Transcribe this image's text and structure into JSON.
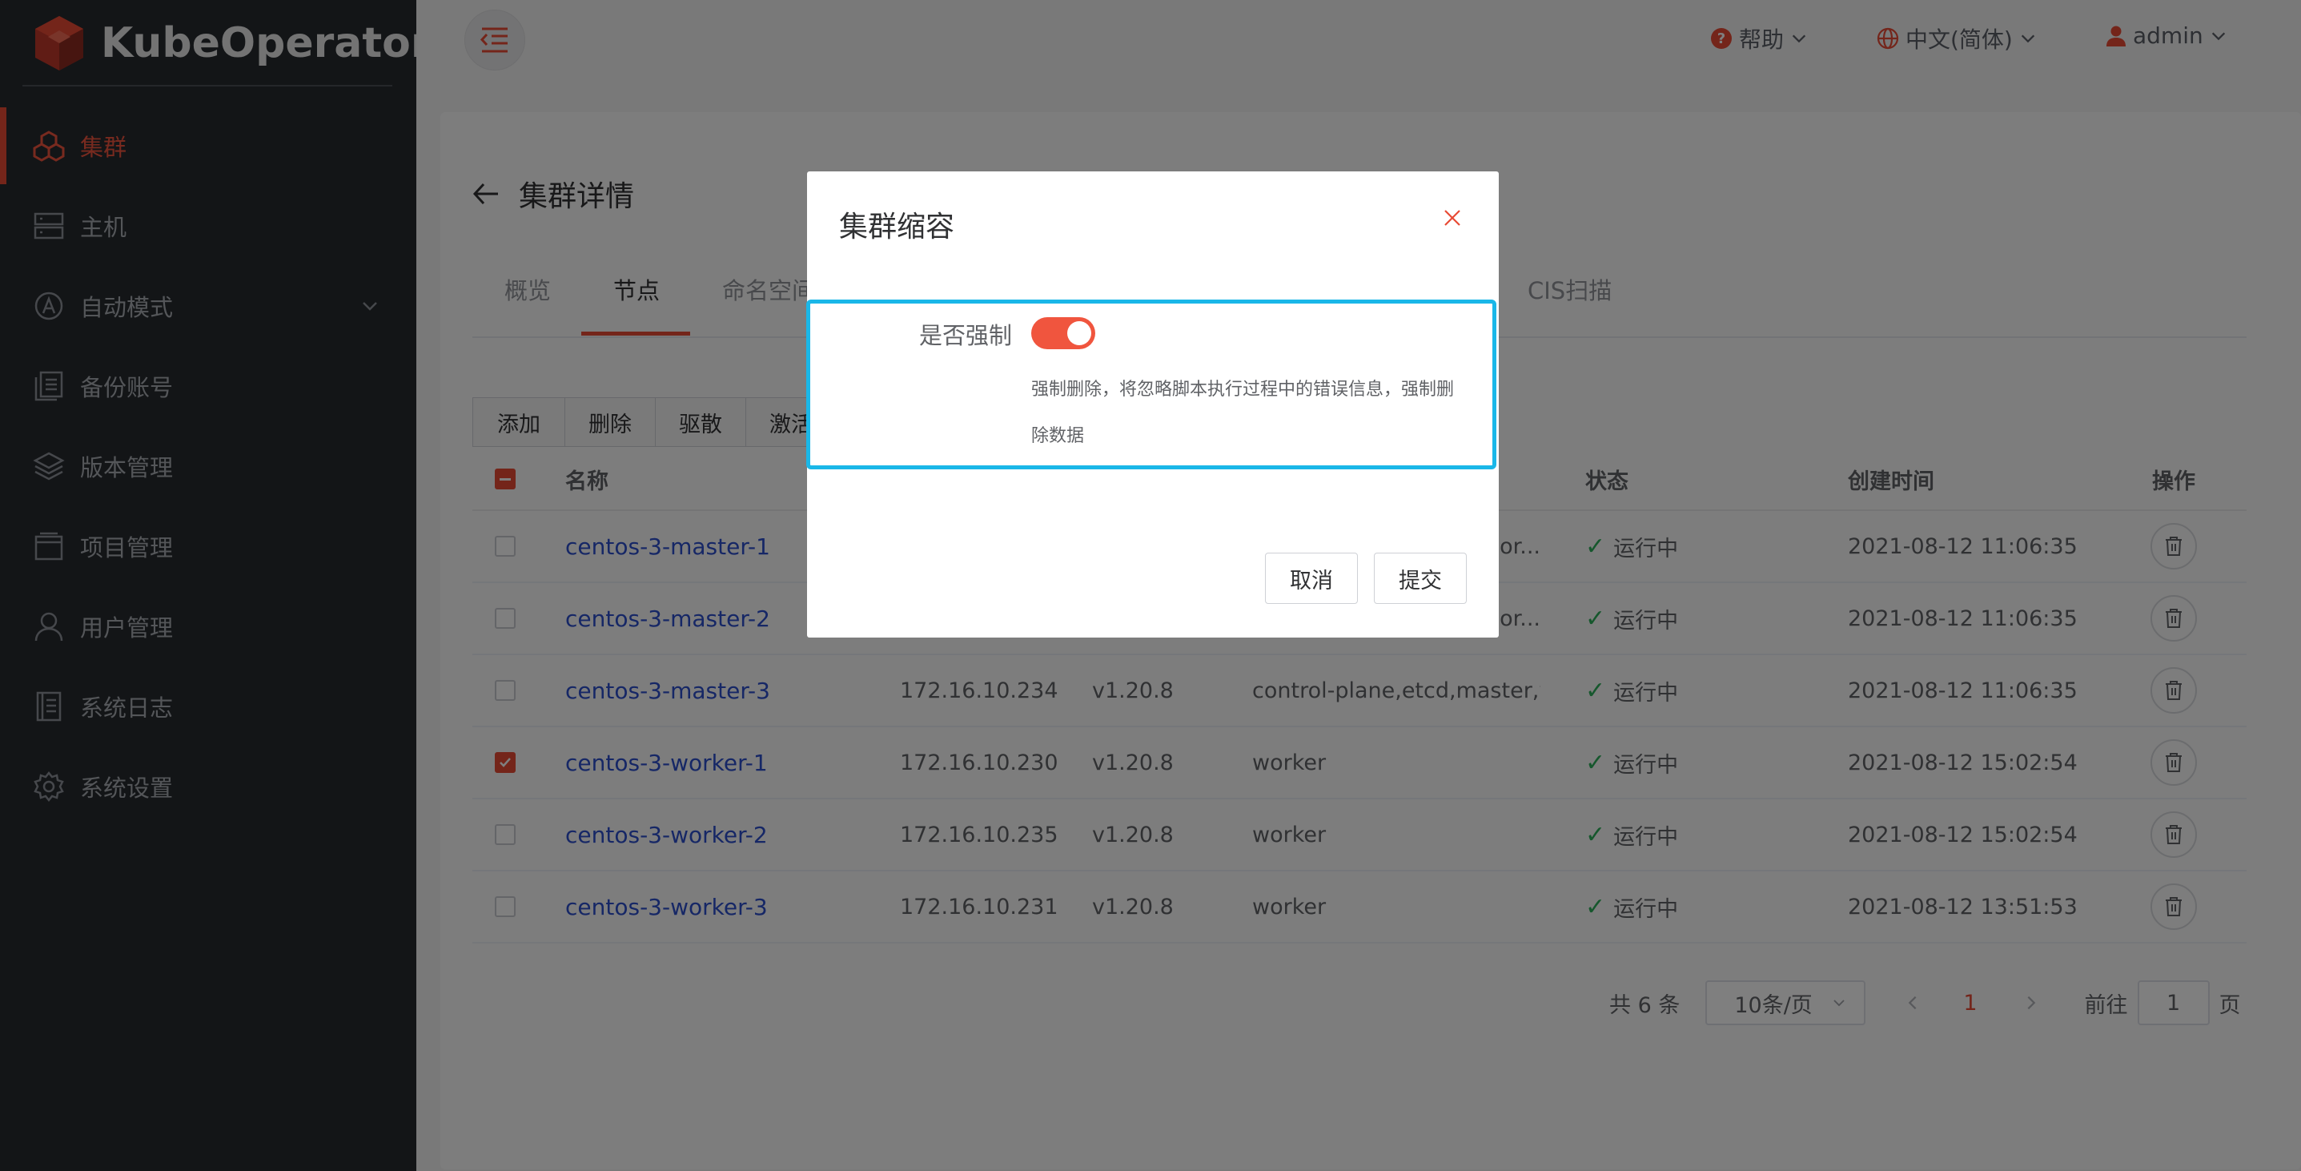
{
  "brand": {
    "name": "KubeOperator",
    "accent": "#e84a35"
  },
  "sidebar": {
    "items": [
      {
        "label": "集群",
        "icon": "cluster-icon",
        "active": true
      },
      {
        "label": "主机",
        "icon": "server-icon"
      },
      {
        "label": "自动模式",
        "icon": "auto-mode-icon",
        "expandable": true
      },
      {
        "label": "备份账号",
        "icon": "backup-icon"
      },
      {
        "label": "版本管理",
        "icon": "layers-icon"
      },
      {
        "label": "项目管理",
        "icon": "project-icon"
      },
      {
        "label": "用户管理",
        "icon": "user-icon"
      },
      {
        "label": "系统日志",
        "icon": "log-icon"
      },
      {
        "label": "系统设置",
        "icon": "gear-icon"
      }
    ]
  },
  "header": {
    "help": "帮助",
    "language": "中文(简体)",
    "user": "admin"
  },
  "page": {
    "title": "集群详情",
    "tabs": [
      "概览",
      "节点",
      "命名空间",
      "CIS扫描"
    ],
    "active_tab": "节点",
    "actions": [
      "添加",
      "删除",
      "驱散",
      "激活"
    ]
  },
  "table": {
    "columns": {
      "name": "名称",
      "status": "状态",
      "created": "创建时间",
      "ops": "操作"
    },
    "rows": [
      {
        "name": "centos-3-master-1",
        "ip": "",
        "version": "",
        "roles": "wor...",
        "status": "运行中",
        "created": "2021-08-12 11:06:35",
        "checked": false
      },
      {
        "name": "centos-3-master-2",
        "ip": "",
        "version": "",
        "roles": "wor...",
        "status": "运行中",
        "created": "2021-08-12 11:06:35",
        "checked": false
      },
      {
        "name": "centos-3-master-3",
        "ip": "172.16.10.234",
        "version": "v1.20.8",
        "roles": "control-plane,etcd,master,wor...",
        "status": "运行中",
        "created": "2021-08-12 11:06:35",
        "checked": false
      },
      {
        "name": "centos-3-worker-1",
        "ip": "172.16.10.230",
        "version": "v1.20.8",
        "roles": "worker",
        "status": "运行中",
        "created": "2021-08-12 15:02:54",
        "checked": true
      },
      {
        "name": "centos-3-worker-2",
        "ip": "172.16.10.235",
        "version": "v1.20.8",
        "roles": "worker",
        "status": "运行中",
        "created": "2021-08-12 15:02:54",
        "checked": false
      },
      {
        "name": "centos-3-worker-3",
        "ip": "172.16.10.231",
        "version": "v1.20.8",
        "roles": "worker",
        "status": "运行中",
        "created": "2021-08-12 13:51:53",
        "checked": false
      }
    ]
  },
  "pagination": {
    "total": "共 6 条",
    "page_size": "10条/页",
    "current": "1",
    "goto_label": "前往",
    "goto_value": "1",
    "page_suffix": "页"
  },
  "dialog": {
    "title": "集群缩容",
    "force_label": "是否强制",
    "force_on": true,
    "hint": "强制删除，将忽略脚本执行过程中的错误信息，强制删除数据",
    "cancel": "取消",
    "submit": "提交"
  }
}
